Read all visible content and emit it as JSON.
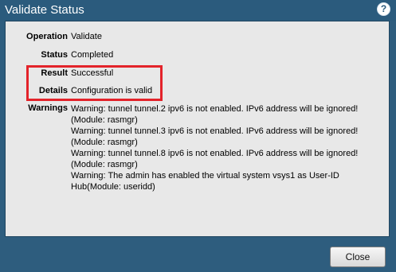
{
  "dialog": {
    "title": "Validate Status",
    "help_icon": "?"
  },
  "fields": {
    "operation": {
      "label": "Operation",
      "value": "Validate"
    },
    "status": {
      "label": "Status",
      "value": "Completed"
    },
    "result": {
      "label": "Result",
      "value": "Successful"
    },
    "details": {
      "label": "Details",
      "value": "Configuration is valid"
    },
    "warnings": {
      "label": "Warnings",
      "lines": [
        "Warning: tunnel tunnel.2 ipv6 is not enabled. IPv6 address will be ignored!",
        "(Module: rasmgr)",
        "Warning: tunnel tunnel.3 ipv6 is not enabled. IPv6 address will be ignored!",
        "(Module: rasmgr)",
        "Warning: tunnel tunnel.8 ipv6 is not enabled. IPv6 address will be ignored!",
        "(Module: rasmgr)",
        "Warning: The admin has enabled the virtual system vsys1 as User-ID",
        "Hub(Module: useridd)"
      ]
    }
  },
  "footer": {
    "close_label": "Close"
  },
  "colors": {
    "titlebar": "#2b5b7d",
    "content_bg": "#e8e8e8",
    "highlight_border": "#e3232a"
  }
}
